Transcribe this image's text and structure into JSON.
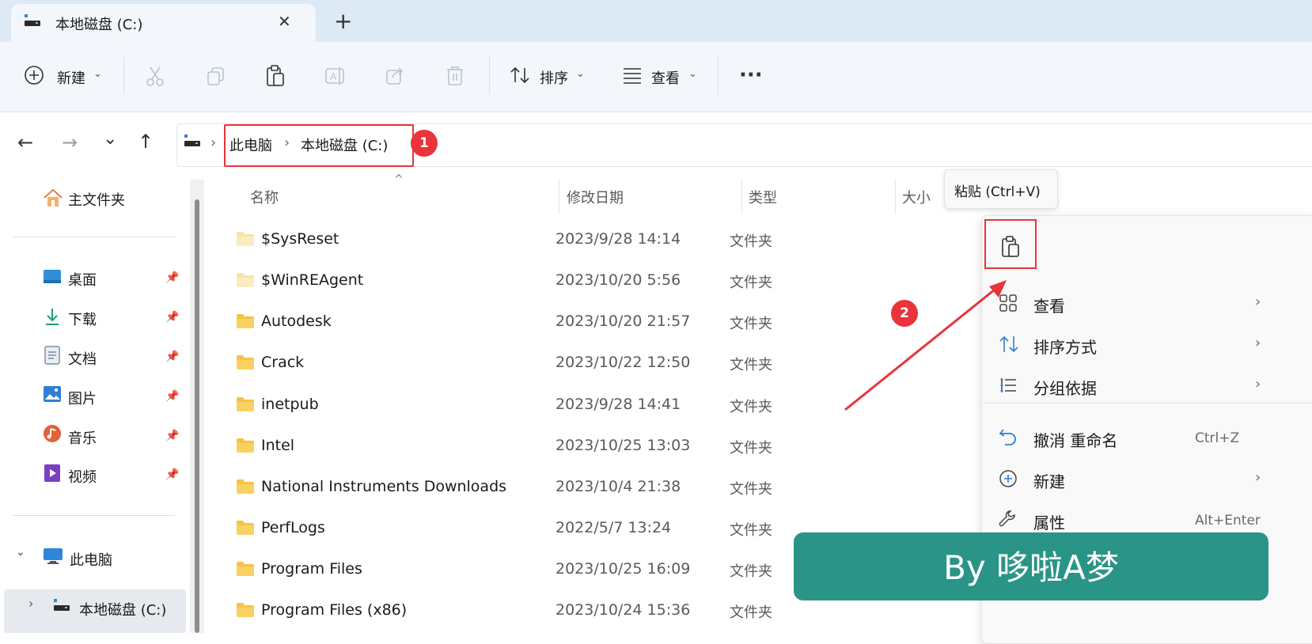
{
  "tab": {
    "title": "本地磁盘 (C:)",
    "close_glyph": "✕",
    "new_tab_glyph": "+"
  },
  "toolbar": {
    "new_label": "新建",
    "sort_label": "排序",
    "view_label": "查看",
    "more_glyph": "···"
  },
  "nav": {
    "back": "←",
    "forward": "→",
    "recent": "⌄",
    "up": "↑"
  },
  "breadcrumb": {
    "items": [
      "此电脑",
      "本地磁盘 (C:)"
    ],
    "separator": "›"
  },
  "annotations": {
    "badge1": "1",
    "badge2": "2",
    "accent_color": "#e8343a"
  },
  "sidebar": {
    "home": "主文件夹",
    "quick": [
      {
        "label": "桌面",
        "icon": "desktop-icon"
      },
      {
        "label": "下载",
        "icon": "download-icon"
      },
      {
        "label": "文档",
        "icon": "document-icon"
      },
      {
        "label": "图片",
        "icon": "pictures-icon"
      },
      {
        "label": "音乐",
        "icon": "music-icon"
      },
      {
        "label": "视频",
        "icon": "video-icon"
      }
    ],
    "this_pc": "此电脑",
    "local_disk": "本地磁盘 (C:)"
  },
  "columns": {
    "name": "名称",
    "date": "修改日期",
    "type": "类型",
    "size": "大小"
  },
  "files": [
    {
      "name": "$SysReset",
      "date": "2023/9/28 14:14",
      "type": "文件夹"
    },
    {
      "name": "$WinREAgent",
      "date": "2023/10/20 5:56",
      "type": "文件夹"
    },
    {
      "name": "Autodesk",
      "date": "2023/10/20 21:57",
      "type": "文件夹"
    },
    {
      "name": "Crack",
      "date": "2023/10/22 12:50",
      "type": "文件夹"
    },
    {
      "name": "inetpub",
      "date": "2023/9/28 14:41",
      "type": "文件夹"
    },
    {
      "name": "Intel",
      "date": "2023/10/25 13:03",
      "type": "文件夹"
    },
    {
      "name": "National Instruments Downloads",
      "date": "2023/10/4 21:38",
      "type": "文件夹"
    },
    {
      "name": "PerfLogs",
      "date": "2022/5/7 13:24",
      "type": "文件夹"
    },
    {
      "name": "Program Files",
      "date": "2023/10/25 16:09",
      "type": "文件夹"
    },
    {
      "name": "Program Files (x86)",
      "date": "2023/10/24 15:36",
      "type": "文件夹"
    }
  ],
  "tooltip": {
    "text": "粘贴 (Ctrl+V)"
  },
  "context_menu": {
    "items": [
      {
        "label": "查看",
        "icon": "grid-icon",
        "submenu": "›"
      },
      {
        "label": "排序方式",
        "icon": "sort-icon",
        "submenu": "›"
      },
      {
        "label": "分组依据",
        "icon": "group-icon",
        "submenu": "›"
      },
      {
        "label": "撤消 重命名",
        "icon": "undo-icon",
        "shortcut": "Ctrl+Z"
      },
      {
        "label": "新建",
        "icon": "new-icon",
        "submenu": "›"
      },
      {
        "label": "属性",
        "icon": "wrench-icon",
        "shortcut": "Alt+Enter"
      }
    ]
  },
  "watermark": {
    "text": "By 哆啦A梦",
    "color": "#2a9486"
  }
}
